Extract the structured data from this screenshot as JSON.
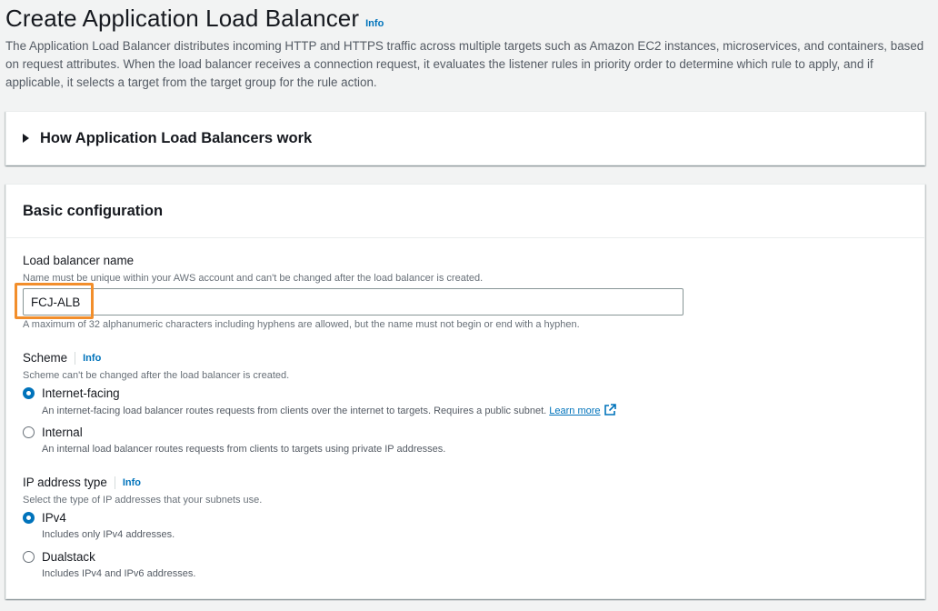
{
  "header": {
    "title": "Create Application Load Balancer",
    "info": "Info",
    "description": "The Application Load Balancer distributes incoming HTTP and HTTPS traffic across multiple targets such as Amazon EC2 instances, microservices, and containers, based on request attributes. When the load balancer receives a connection request, it evaluates the listener rules in priority order to determine which rule to apply, and if applicable, it selects a target from the target group for the rule action."
  },
  "how_section": {
    "title": "How Application Load Balancers work",
    "icon": "caret-right-icon"
  },
  "basic_config": {
    "title": "Basic configuration",
    "name_field": {
      "label": "Load balancer name",
      "description": "Name must be unique within your AWS account and can't be changed after the load balancer is created.",
      "value": "FCJ-ALB",
      "constraint": "A maximum of 32 alphanumeric characters including hyphens are allowed, but the name must not begin or end with a hyphen.",
      "highlight_color": "#f28e2b"
    },
    "scheme": {
      "label": "Scheme",
      "info": "Info",
      "description": "Scheme can't be changed after the load balancer is created.",
      "options": [
        {
          "label": "Internet-facing",
          "description": "An internet-facing load balancer routes requests from clients over the internet to targets. Requires a public subnet.",
          "link": "Learn more",
          "checked": true
        },
        {
          "label": "Internal",
          "description": "An internal load balancer routes requests from clients to targets using private IP addresses.",
          "checked": false
        }
      ]
    },
    "ip_type": {
      "label": "IP address type",
      "info": "Info",
      "description": "Select the type of IP addresses that your subnets use.",
      "options": [
        {
          "label": "IPv4",
          "description": "Includes only IPv4 addresses.",
          "checked": true
        },
        {
          "label": "Dualstack",
          "description": "Includes IPv4 and IPv6 addresses.",
          "checked": false
        }
      ]
    }
  },
  "colors": {
    "accent": "#0073bb",
    "background": "#f2f3f3"
  }
}
